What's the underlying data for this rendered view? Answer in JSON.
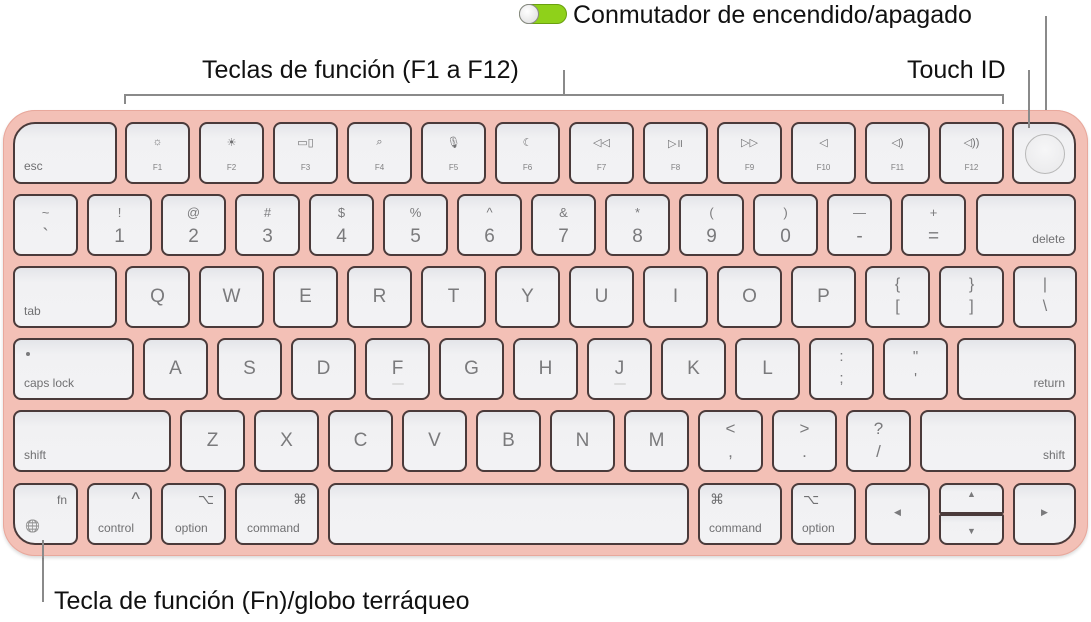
{
  "callouts": {
    "power_switch": "Conmutador de encendido/apagado",
    "function_keys": "Teclas de función (F1 a F12)",
    "touch_id": "Touch ID",
    "fn_globe": "Tecla de función (Fn)/globo terráqueo"
  },
  "colors": {
    "keyboard_body": "#f3c0b6",
    "switch_on": "#8fd11a",
    "key_face": "#f1f1f3"
  },
  "power_switch_state": "on",
  "rows": {
    "function": {
      "esc": "esc",
      "keys": [
        {
          "icon": "☼",
          "label": "F1",
          "name": "brightness-down-icon"
        },
        {
          "icon": "☀",
          "label": "F2",
          "name": "brightness-up-icon"
        },
        {
          "icon": "▭▯",
          "label": "F3",
          "name": "mission-control-icon"
        },
        {
          "icon": "⌕",
          "label": "F4",
          "name": "spotlight-search-icon"
        },
        {
          "icon": "🎙",
          "label": "F5",
          "name": "dictation-mic-icon"
        },
        {
          "icon": "☾",
          "label": "F6",
          "name": "do-not-disturb-moon-icon"
        },
        {
          "icon": "◁◁",
          "label": "F7",
          "name": "rewind-icon"
        },
        {
          "icon": "▷॥",
          "label": "F8",
          "name": "play-pause-icon"
        },
        {
          "icon": "▷▷",
          "label": "F9",
          "name": "fast-forward-icon"
        },
        {
          "icon": "◁",
          "label": "F10",
          "name": "mute-icon"
        },
        {
          "icon": "◁)",
          "label": "F11",
          "name": "volume-down-icon"
        },
        {
          "icon": "◁))",
          "label": "F12",
          "name": "volume-up-icon"
        }
      ]
    },
    "number": {
      "keys": [
        {
          "top": "~",
          "main": "`"
        },
        {
          "top": "!",
          "main": "1"
        },
        {
          "top": "@",
          "main": "2"
        },
        {
          "top": "#",
          "main": "3"
        },
        {
          "top": "$",
          "main": "4"
        },
        {
          "top": "%",
          "main": "5"
        },
        {
          "top": "^",
          "main": "6"
        },
        {
          "top": "&",
          "main": "7"
        },
        {
          "top": "*",
          "main": "8"
        },
        {
          "top": "(",
          "main": "9"
        },
        {
          "top": ")",
          "main": "0"
        },
        {
          "top": "—",
          "main": "-"
        },
        {
          "top": "+",
          "main": "="
        }
      ],
      "delete": "delete"
    },
    "qwerty": {
      "tab": "tab",
      "keys": [
        "Q",
        "W",
        "E",
        "R",
        "T",
        "Y",
        "U",
        "I",
        "O",
        "P"
      ],
      "brackets": [
        {
          "top": "{",
          "main": "["
        },
        {
          "top": "}",
          "main": "]"
        },
        {
          "top": "|",
          "main": "\\"
        }
      ]
    },
    "home": {
      "caps": "caps lock",
      "keys": [
        "A",
        "S",
        "D",
        "F",
        "G",
        "H",
        "J",
        "K",
        "L"
      ],
      "punct": [
        {
          "top": ":",
          "main": ";"
        },
        {
          "top": "\"",
          "main": "'"
        }
      ],
      "return": "return"
    },
    "shift": {
      "left": "shift",
      "keys": [
        "Z",
        "X",
        "C",
        "V",
        "B",
        "N",
        "M"
      ],
      "punct": [
        {
          "top": "<",
          "main": ","
        },
        {
          "top": ">",
          "main": "."
        },
        {
          "top": "?",
          "main": "/"
        }
      ],
      "right": "shift"
    },
    "bottom": {
      "fn": "fn",
      "globe": "🌐",
      "control_sym": "^",
      "control": "control",
      "option_sym": "⌥",
      "option": "option",
      "command_sym": "⌘",
      "command": "command",
      "command_r_sym": "⌘",
      "command_r": "command",
      "option_r_sym": "⌥",
      "option_r": "option",
      "left": "◀",
      "up": "▲",
      "down": "▼",
      "right": "▶"
    }
  }
}
